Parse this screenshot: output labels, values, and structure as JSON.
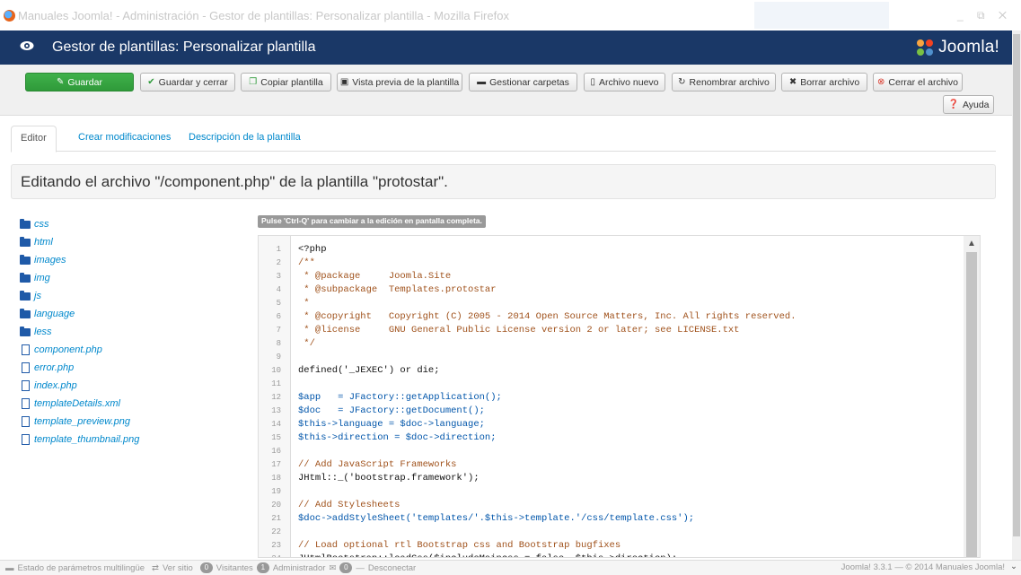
{
  "window": {
    "title": "Manuales Joomla! - Administración - Gestor de plantillas: Personalizar plantilla - Mozilla Firefox",
    "controls": "_ ⧉ ✕"
  },
  "header": {
    "title": "Gestor de plantillas: Personalizar plantilla",
    "logo_text": "Joomla!",
    "colors": {
      "bar": "#1a3867",
      "save": "#2f9a3a",
      "link": "#0088cc"
    }
  },
  "toolbar": {
    "buttons": [
      {
        "label": "Guardar",
        "icon": "edit-icon"
      },
      {
        "label": "Guardar y cerrar",
        "icon": "check-icon"
      },
      {
        "label": "Copiar plantilla",
        "icon": "copy-icon"
      },
      {
        "label": "Vista previa de la plantilla",
        "icon": "picture-icon"
      },
      {
        "label": "Gestionar carpetas",
        "icon": "folder-icon"
      },
      {
        "label": "Archivo nuevo",
        "icon": "file-icon"
      },
      {
        "label": "Renombrar archivo",
        "icon": "refresh-icon"
      },
      {
        "label": "Borrar archivo",
        "icon": "remove-icon"
      },
      {
        "label": "Cerrar el archivo",
        "icon": "cancel-icon"
      }
    ],
    "help_label": "Ayuda"
  },
  "tabs": [
    "Editor",
    "Crear modificaciones",
    "Descripción de la plantilla"
  ],
  "banner": "Editando el archivo \"/component.php\" de la plantilla \"protostar\".",
  "tree": {
    "folders": [
      "css",
      "html",
      "images",
      "img",
      "js",
      "language",
      "less"
    ],
    "files": [
      "component.php",
      "error.php",
      "index.php",
      "templateDetails.xml",
      "template_preview.png",
      "template_thumbnail.png"
    ]
  },
  "hint": "Pulse 'Ctrl-Q' para cambiar a la edición en pantalla completa.",
  "code_lines": [
    "<?php",
    "/**",
    " * @package     Joomla.Site",
    " * @subpackage  Templates.protostar",
    " *",
    " * @copyright   Copyright (C) 2005 - 2014 Open Source Matters, Inc. All rights reserved.",
    " * @license     GNU General Public License version 2 or later; see LICENSE.txt",
    " */",
    "",
    "defined('_JEXEC') or die;",
    "",
    "$app   = JFactory::getApplication();",
    "$doc   = JFactory::getDocument();",
    "$this->language = $doc->language;",
    "$this->direction = $doc->direction;",
    "",
    "// Add JavaScript Frameworks",
    "JHtml::_('bootstrap.framework');",
    "",
    "// Add Stylesheets",
    "$doc->addStyleSheet('templates/'.$this->template.'/css/template.css');",
    "",
    "// Load optional rtl Bootstrap css and Bootstrap bugfixes",
    "JHtmlBootstrap::loadCss($includeMaincss = false, $this->direction);"
  ],
  "status": {
    "multilang": "Estado de parámetros multilingüe",
    "view_site": "Ver sitio",
    "visitors_count": "0",
    "visitors": "Visitantes",
    "admins_count": "1",
    "admins": "Administrador",
    "messages_count": "0",
    "logout": "Desconectar",
    "footer": "Joomla! 3.3.1 — © 2014 Manuales Joomla!"
  }
}
